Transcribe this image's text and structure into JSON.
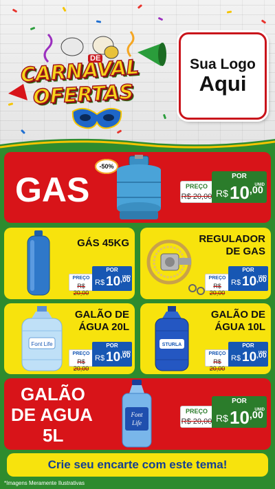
{
  "header": {
    "logo_line1": "CARNAVAL",
    "logo_de": "DE",
    "logo_line2": "OFERTAS",
    "store_logo_line1": "Sua Logo",
    "store_logo_line2": "Aqui"
  },
  "products": {
    "gas": {
      "title": "GAS",
      "discount": "-50%",
      "preco_label": "PREÇO",
      "old_price": "R$ 20,00",
      "por_label": "POR",
      "currency": "R$",
      "price_int": "10",
      "price_cents": ",00",
      "unit": "UNID"
    },
    "gas45": {
      "title": "GÁS 45KG",
      "preco_label": "PREÇO",
      "old_price": "R$ 20,00",
      "por_label": "POR",
      "currency": "R$",
      "price_int": "10",
      "price_cents": ",00",
      "unit": "UNID"
    },
    "regulador": {
      "title_line1": "REGULADOR",
      "title_line2": "DE GAS",
      "preco_label": "PREÇO",
      "old_price": "R$ 20,00",
      "por_label": "POR",
      "currency": "R$",
      "price_int": "10",
      "price_cents": ",00",
      "unit": "UNID"
    },
    "galao20": {
      "title_line1": "GALÃO DE",
      "title_line2": "ÁGUA 20L",
      "preco_label": "PREÇO",
      "old_price": "R$ 20,00",
      "por_label": "POR",
      "currency": "R$",
      "price_int": "10",
      "price_cents": ",00",
      "unit": "UNID",
      "bottle_label": "Font Life"
    },
    "galao10": {
      "title_line1": "GALÃO DE",
      "title_line2": "ÁGUA 10L",
      "preco_label": "PREÇO",
      "old_price": "R$ 20,00",
      "por_label": "POR",
      "currency": "R$",
      "price_int": "10",
      "price_cents": ",00",
      "unit": "UNID",
      "bottle_label": "STURLA"
    },
    "galao5": {
      "title_line1": "GALÃO",
      "title_line2": "DE AGUA",
      "title_line3": "5L",
      "preco_label": "PREÇO",
      "old_price": "R$ 20,00",
      "por_label": "POR",
      "currency": "R$",
      "price_int": "10",
      "price_cents": ",00",
      "unit": "UNID",
      "bottle_label_1": "Font",
      "bottle_label_2": "Life"
    }
  },
  "footer": {
    "cta": "Crie seu encarte com este tema!",
    "disclaimer": "*Imagens Meramente Ilustrativas"
  },
  "colors": {
    "background_green": "#2e8b2e",
    "card_red": "#d81419",
    "card_yellow": "#f7e30d",
    "tag_green": "#2b7c2b",
    "tag_blue": "#1757b3",
    "footer_text": "#143f93"
  }
}
